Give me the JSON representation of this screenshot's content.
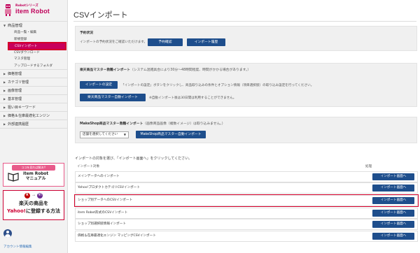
{
  "logo": {
    "series": "Robotシリーズ",
    "name": "item Robot"
  },
  "sidebar": {
    "groups": [
      {
        "label": "商品管理",
        "open": true,
        "items": [
          {
            "label": "商品一覧・編集"
          },
          {
            "label": "新規登録"
          },
          {
            "label": "CSVインポート",
            "active": true
          },
          {
            "label": "CSVダウンロード"
          },
          {
            "label": "マスタ管理"
          },
          {
            "label": "アップロードするフォルダ"
          }
        ]
      },
      {
        "label": "価格管理"
      },
      {
        "label": "カテゴリ管理"
      },
      {
        "label": "画像管理"
      },
      {
        "label": "基本管理"
      },
      {
        "label": "狙い目キーワード"
      },
      {
        "label": "価格＆在庫最適化エンジン"
      },
      {
        "label": "外部連携履歴"
      }
    ]
  },
  "promo_manual": {
    "tag": "ココを見れば解決!!",
    "line1": "item Robot",
    "line2": "マニュアル"
  },
  "promo_yahoo": {
    "badge_r": "R",
    "badge_y": "Y!",
    "line1": "楽天の商品を",
    "line2a": "Yahoo!",
    "line2b": "に登録する方法"
  },
  "account": {
    "label": "アカウント情報編集"
  },
  "page": {
    "title": "CSVインポート"
  },
  "panel_reserve": {
    "title": "予約状況",
    "text": "インポートの予約状況をご確認いただけます。",
    "btn_confirm": "予約確認",
    "btn_history": "インポート履歴"
  },
  "panel_rakuten": {
    "title": "楽天商品マスター救難インポート",
    "note": "（システム混雑具合により30分〜48時間程度、時間がかかる場合があります。）",
    "btn_settings": "インポートの設定",
    "settings_text": "「インポートの設定」ボタンをクリックし、商品取り込みの条件とオプション情報（項目選択肢）の取り込み設定を行ってください。",
    "btn_auto": "楽天商品マスター自動インポート",
    "auto_text": "※自動インポート後は30日間は利用することができません。"
  },
  "panel_makeshop": {
    "title": "MakeShop商品マスター救難インポート",
    "note": "（画像商品画像（複数イメージ）は取り込みません。）",
    "select_value": "店舗を選択してください",
    "btn_auto": "MakeShop商品マスター自動インポート"
  },
  "intro_text": "インポートの対象を選び、「インポート画面へ」をクリックしてください。",
  "table": {
    "col_target": "インポート対象",
    "col_action": "処理",
    "rows": [
      {
        "label": "メインデータへのインポート",
        "action": "インポート画面へ"
      },
      {
        "label": "Yahoo!プロダクトカテゴリCSVインポート",
        "action": "インポート画面へ"
      },
      {
        "label": "ショップ別データへのCSVインポート",
        "action": "インポート画面へ",
        "highlight": true
      },
      {
        "label": "item Robot形式のCSVインポート",
        "action": "インポート画面へ"
      },
      {
        "label": "ショップ別選択肢情報インポート",
        "action": "インポート画面へ"
      },
      {
        "label": "価格＆在庫最適化エンジン マッピングCSVインポート",
        "action": "インポート画面へ"
      }
    ]
  },
  "colors": {
    "brand": "#c0005a",
    "button": "#1e4e8c",
    "highlight": "#d4002a"
  }
}
